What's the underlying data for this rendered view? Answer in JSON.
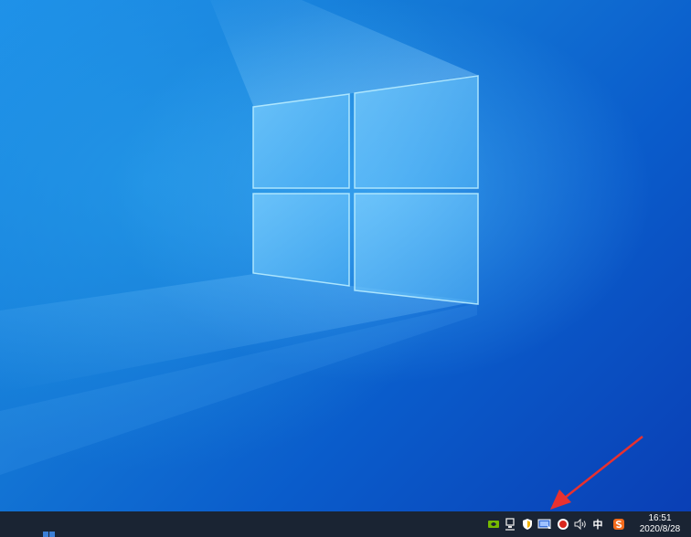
{
  "taskbar": {
    "tray": {
      "ime_label": "中",
      "icons": [
        "nvidia-icon",
        "network-icon",
        "security-shield-icon",
        "display-settings-icon",
        "record-icon",
        "volume-icon",
        "sogou-input-icon"
      ]
    },
    "clock": {
      "time": "16:51",
      "date": "2020/8/28"
    }
  },
  "annotation": {
    "arrow_color": "#e8312f"
  },
  "colors": {
    "taskbar": "#1a2433",
    "desktop_accent": "#1479d6"
  }
}
